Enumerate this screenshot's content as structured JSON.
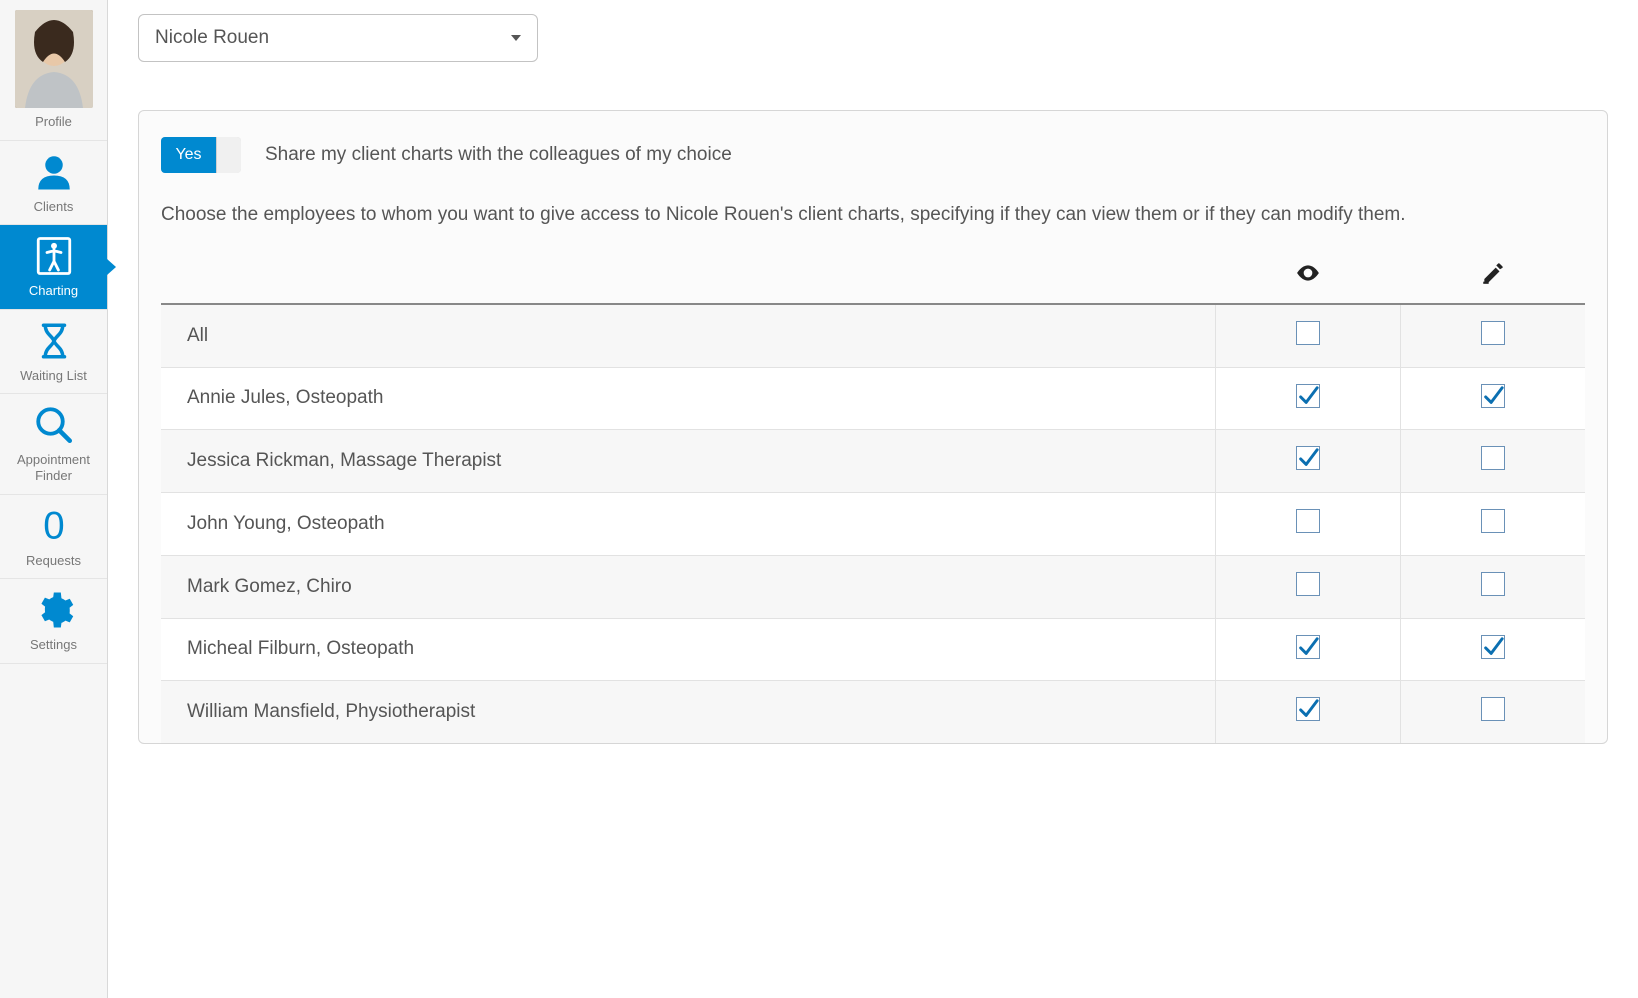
{
  "sidebar": {
    "items": [
      {
        "label": "Profile"
      },
      {
        "label": "Clients"
      },
      {
        "label": "Charting"
      },
      {
        "label": "Waiting List"
      },
      {
        "label": "Appointment Finder"
      },
      {
        "label": "Requests"
      },
      {
        "label": "Settings"
      }
    ],
    "active_index": 2
  },
  "selector": {
    "selected": "Nicole Rouen"
  },
  "share": {
    "toggle_text": "Yes",
    "label": "Share my client charts with the colleagues of my choice",
    "description": "Choose the employees to whom you want to give access to Nicole Rouen's client charts, specifying if they can view them or if they can modify them."
  },
  "table": {
    "header_icons": [
      "eye-icon",
      "edit-icon"
    ],
    "rows": [
      {
        "name": "All",
        "view": false,
        "edit": false
      },
      {
        "name": "Annie Jules, Osteopath",
        "view": true,
        "edit": true
      },
      {
        "name": "Jessica Rickman, Massage Therapist",
        "view": true,
        "edit": false
      },
      {
        "name": "John Young, Osteopath",
        "view": false,
        "edit": false
      },
      {
        "name": "Mark Gomez, Chiro",
        "view": false,
        "edit": false
      },
      {
        "name": "Micheal Filburn, Osteopath",
        "view": true,
        "edit": true
      },
      {
        "name": "William Mansfield, Physiotherapist",
        "view": true,
        "edit": false
      }
    ]
  }
}
